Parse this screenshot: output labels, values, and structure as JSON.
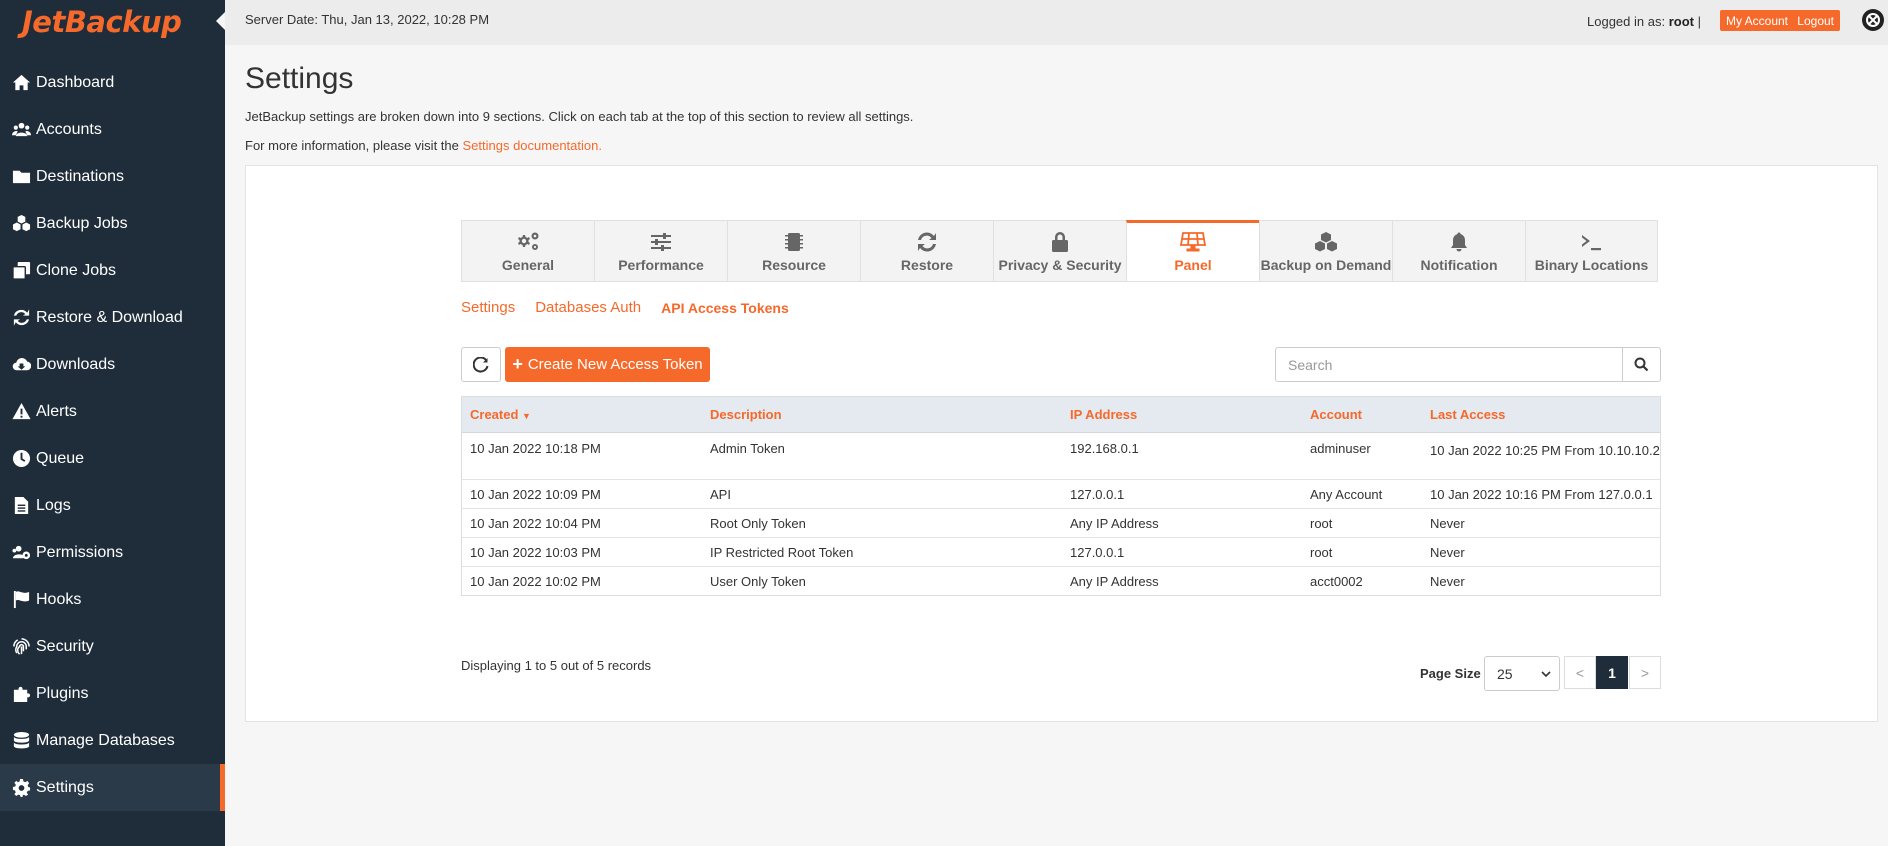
{
  "brand": {
    "name": "JetBackup",
    "accent": "#f5692b",
    "sidebar_bg": "#1f2d3a"
  },
  "topbar": {
    "server_date": "Server Date: Thu, Jan 13, 2022, 10:28 PM",
    "logged_in_prefix": "Logged in as:",
    "user": "root",
    "separator": "|",
    "my_account": "My Account",
    "logout": "Logout"
  },
  "sidebar": {
    "items": [
      {
        "label": "Dashboard",
        "icon": "home-icon"
      },
      {
        "label": "Accounts",
        "icon": "users-icon"
      },
      {
        "label": "Destinations",
        "icon": "folder-icon"
      },
      {
        "label": "Backup Jobs",
        "icon": "cubes-icon"
      },
      {
        "label": "Clone Jobs",
        "icon": "clone-icon"
      },
      {
        "label": "Restore & Download",
        "icon": "sync-icon"
      },
      {
        "label": "Downloads",
        "icon": "cloud-download-icon"
      },
      {
        "label": "Alerts",
        "icon": "warning-icon"
      },
      {
        "label": "Queue",
        "icon": "clock-icon"
      },
      {
        "label": "Logs",
        "icon": "file-icon"
      },
      {
        "label": "Permissions",
        "icon": "users-cog-icon"
      },
      {
        "label": "Hooks",
        "icon": "flag-icon"
      },
      {
        "label": "Security",
        "icon": "fingerprint-icon"
      },
      {
        "label": "Plugins",
        "icon": "puzzle-icon"
      },
      {
        "label": "Manage Databases",
        "icon": "database-icon"
      },
      {
        "label": "Settings",
        "icon": "gear-icon",
        "active": true
      }
    ]
  },
  "page": {
    "title": "Settings",
    "intro": "JetBackup settings are broken down into 9 sections. Click on each tab at the top of this section to review all settings.",
    "more_info_prefix": "For more information, please visit the ",
    "more_info_link": "Settings documentation."
  },
  "tabs": [
    {
      "label": "General",
      "icon": "gears-icon"
    },
    {
      "label": "Performance",
      "icon": "sliders-icon"
    },
    {
      "label": "Resource",
      "icon": "microchip-icon"
    },
    {
      "label": "Restore",
      "icon": "sync-icon"
    },
    {
      "label": "Privacy & Security",
      "icon": "lock-icon"
    },
    {
      "label": "Panel",
      "icon": "solar-panel-icon",
      "active": true
    },
    {
      "label": "Backup on Demand",
      "icon": "cubes-icon"
    },
    {
      "label": "Notification",
      "icon": "bell-icon"
    },
    {
      "label": "Binary Locations",
      "icon": "terminal-icon"
    }
  ],
  "subtabs": [
    {
      "label": "Settings"
    },
    {
      "label": "Databases Auth"
    },
    {
      "label": "API Access Tokens",
      "active": true
    }
  ],
  "toolbar": {
    "create_label": "Create New Access Token",
    "search_placeholder": "Search"
  },
  "table": {
    "columns": [
      "Created",
      "Description",
      "IP Address",
      "Account",
      "Last Access"
    ],
    "sort_column": "Created",
    "rows": [
      {
        "created": "10 Jan 2022 10:18 PM",
        "description": "Admin Token",
        "ip": "192.168.0.1",
        "account": "adminuser",
        "last_access": "10 Jan 2022 10:25 PM From 10.10.10.2"
      },
      {
        "created": "10 Jan 2022 10:09 PM",
        "description": "API",
        "ip": "127.0.0.1",
        "account": "Any Account",
        "last_access": "10 Jan 2022 10:16 PM From 127.0.0.1"
      },
      {
        "created": "10 Jan 2022 10:04 PM",
        "description": "Root Only Token",
        "ip": "Any IP Address",
        "account": "root",
        "last_access": "Never"
      },
      {
        "created": "10 Jan 2022 10:03 PM",
        "description": "IP Restricted Root Token",
        "ip": "127.0.0.1",
        "account": "root",
        "last_access": "Never"
      },
      {
        "created": "10 Jan 2022 10:02 PM",
        "description": "User Only Token",
        "ip": "Any IP Address",
        "account": "acct0002",
        "last_access": "Never"
      }
    ]
  },
  "footer": {
    "display_info": "Displaying 1 to 5 out of 5 records",
    "page_size_label": "Page Size",
    "page_size": "25",
    "prev": "<",
    "current_page": "1",
    "next": ">"
  }
}
